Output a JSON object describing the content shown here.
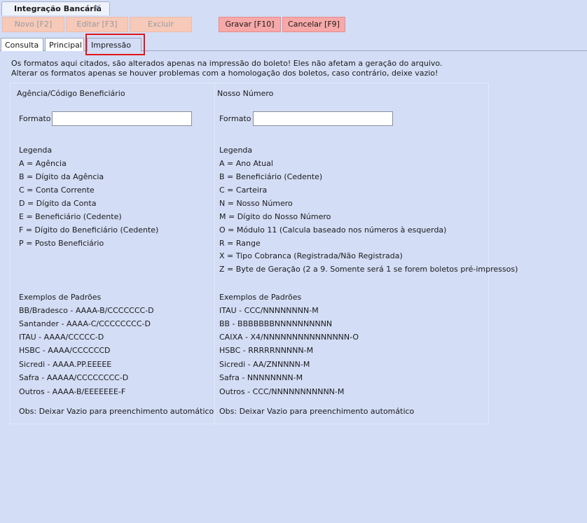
{
  "window": {
    "title": "Integração Bancária"
  },
  "toolbar": {
    "novo": "Novo [F2]",
    "editar": "Editar [F3]",
    "excluir": "Excluir",
    "gravar": "Gravar [F10]",
    "cancelar": "Cancelar [F9]"
  },
  "tabs": {
    "consulta": "Consulta",
    "principal": "Principal",
    "impressao": "Impressão"
  },
  "info": {
    "line1": "Os formatos aqui citados, são alterados apenas na impressão do boleto! Eles não afetam a geração do arquivo.",
    "line2": "Alterar os formatos apenas se houver problemas com a homologação dos boletos, caso contrário, deixe vazio!"
  },
  "left": {
    "title": "Agência/Código Beneficiário",
    "format_label": "Formato",
    "format_value": "",
    "legend_title": "Legenda",
    "legend": [
      "A = Agência",
      "B = Dígito da Agência",
      "C = Conta Corrente",
      "D = Dígito da Conta",
      "E = Beneficiário (Cedente)",
      "F = Dígito do Beneficiário (Cedente)",
      "P = Posto Beneficiário"
    ],
    "examples_title": "Exemplos de Padrões",
    "examples": [
      "BB/Bradesco - AAAA-B/CCCCCCC-D",
      "Santander - AAAA-C/CCCCCCCC-D",
      "ITAU - AAAA/CCCCC-D",
      "HSBC - AAAA/CCCCCCD",
      "Sicredi - AAAA.PP.EEEEE",
      "Safra - AAAAA/CCCCCCCC-D",
      "Outros - AAAA-B/EEEEEEE-F"
    ],
    "obs": "Obs: Deixar Vazio para preenchimento automático"
  },
  "right": {
    "title": "Nosso Número",
    "format_label": "Formato",
    "format_value": "",
    "legend_title": "Legenda",
    "legend": [
      "A = Ano Atual",
      "B = Beneficiário (Cedente)",
      "C = Carteira",
      "N = Nosso Número",
      "M = Dígito do Nosso Número",
      "O = Módulo 11 (Calcula baseado nos números à esquerda)",
      "R = Range",
      "X = Tipo Cobranca (Registrada/Não Registrada)",
      "Z = Byte de Geração (2 a 9.  Somente será 1 se forem boletos pré-impressos)"
    ],
    "examples_title": "Exemplos de Padrões",
    "examples": [
      "ITAU - CCC/NNNNNNNN-M",
      "BB - BBBBBBBNNNNNNNNNN",
      "CAIXA - X4/NNNNNNNNNNNNNNN-O",
      "HSBC - RRRRRNNNNN-M",
      "Sicredi - AA/ZNNNNN-M",
      "Safra - NNNNNNNN-M",
      "Outros - CCC/NNNNNNNNNNN-M"
    ],
    "obs": "Obs: Deixar Vazio para preenchimento automático"
  }
}
